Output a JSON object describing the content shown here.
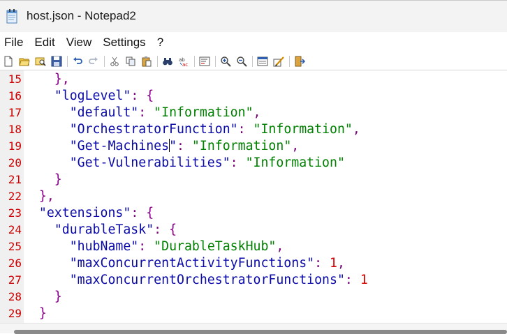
{
  "window": {
    "title": "host.json - Notepad2",
    "icon": "notepad-icon"
  },
  "menu": {
    "items": [
      "File",
      "Edit",
      "View",
      "Settings",
      "?"
    ]
  },
  "toolbar": {
    "buttons": [
      "new-file-icon",
      "open-folder-icon",
      "browse-icon",
      "save-icon",
      "undo-icon",
      "redo-icon",
      "cut-icon",
      "copy-icon",
      "paste-icon",
      "find-icon",
      "replace-icon",
      "word-wrap-icon",
      "zoom-in-icon",
      "zoom-out-icon",
      "scheme-icon",
      "customize-scheme-icon",
      "exit-icon"
    ]
  },
  "colors": {
    "key": "#0a0aa8",
    "string": "#008000",
    "brace": "#8a008a",
    "number": "#d40000",
    "line_number": "#cc0000",
    "gutter": "#f0f0f0"
  },
  "editor": {
    "lines": [
      {
        "n": "15",
        "tokens": [
          [
            "p",
            "    },"
          ]
        ]
      },
      {
        "n": "16",
        "tokens": [
          [
            "p",
            "    "
          ],
          [
            "k",
            "\"logLevel\""
          ],
          [
            "o",
            ": "
          ],
          [
            "p",
            "{"
          ]
        ]
      },
      {
        "n": "17",
        "tokens": [
          [
            "p",
            "      "
          ],
          [
            "k",
            "\"default\""
          ],
          [
            "o",
            ": "
          ],
          [
            "s",
            "\"Information\""
          ],
          [
            "o",
            ","
          ]
        ]
      },
      {
        "n": "18",
        "tokens": [
          [
            "p",
            "      "
          ],
          [
            "k",
            "\"OrchestratorFunction\""
          ],
          [
            "o",
            ": "
          ],
          [
            "s",
            "\"Information\""
          ],
          [
            "o",
            ","
          ]
        ]
      },
      {
        "n": "19",
        "tokens": [
          [
            "p",
            "      "
          ],
          [
            "k",
            "\"Get-Machines"
          ],
          [
            "caret",
            ""
          ],
          [
            "k",
            "\""
          ],
          [
            "o",
            ": "
          ],
          [
            "s",
            "\"Information\""
          ],
          [
            "o",
            ","
          ]
        ]
      },
      {
        "n": "20",
        "tokens": [
          [
            "p",
            "      "
          ],
          [
            "k",
            "\"Get-Vulnerabilities\""
          ],
          [
            "o",
            ": "
          ],
          [
            "s",
            "\"Information\""
          ]
        ]
      },
      {
        "n": "21",
        "tokens": [
          [
            "p",
            "    }"
          ]
        ]
      },
      {
        "n": "22",
        "tokens": [
          [
            "p",
            "  },"
          ]
        ]
      },
      {
        "n": "23",
        "tokens": [
          [
            "p",
            "  "
          ],
          [
            "k",
            "\"extensions\""
          ],
          [
            "o",
            ": "
          ],
          [
            "p",
            "{"
          ]
        ]
      },
      {
        "n": "24",
        "tokens": [
          [
            "p",
            "    "
          ],
          [
            "k",
            "\"durableTask\""
          ],
          [
            "o",
            ": "
          ],
          [
            "p",
            "{"
          ]
        ]
      },
      {
        "n": "25",
        "tokens": [
          [
            "p",
            "      "
          ],
          [
            "k",
            "\"hubName\""
          ],
          [
            "o",
            ": "
          ],
          [
            "s",
            "\"DurableTaskHub\""
          ],
          [
            "o",
            ","
          ]
        ]
      },
      {
        "n": "26",
        "tokens": [
          [
            "p",
            "      "
          ],
          [
            "k",
            "\"maxConcurrentActivityFunctions\""
          ],
          [
            "o",
            ": "
          ],
          [
            "n",
            "1"
          ],
          [
            "o",
            ","
          ]
        ]
      },
      {
        "n": "27",
        "tokens": [
          [
            "p",
            "      "
          ],
          [
            "k",
            "\"maxConcurrentOrchestratorFunctions\""
          ],
          [
            "o",
            ": "
          ],
          [
            "n",
            "1"
          ]
        ]
      },
      {
        "n": "28",
        "tokens": [
          [
            "p",
            "    }"
          ]
        ]
      },
      {
        "n": "29",
        "tokens": [
          [
            "p",
            "  }"
          ]
        ]
      }
    ]
  }
}
